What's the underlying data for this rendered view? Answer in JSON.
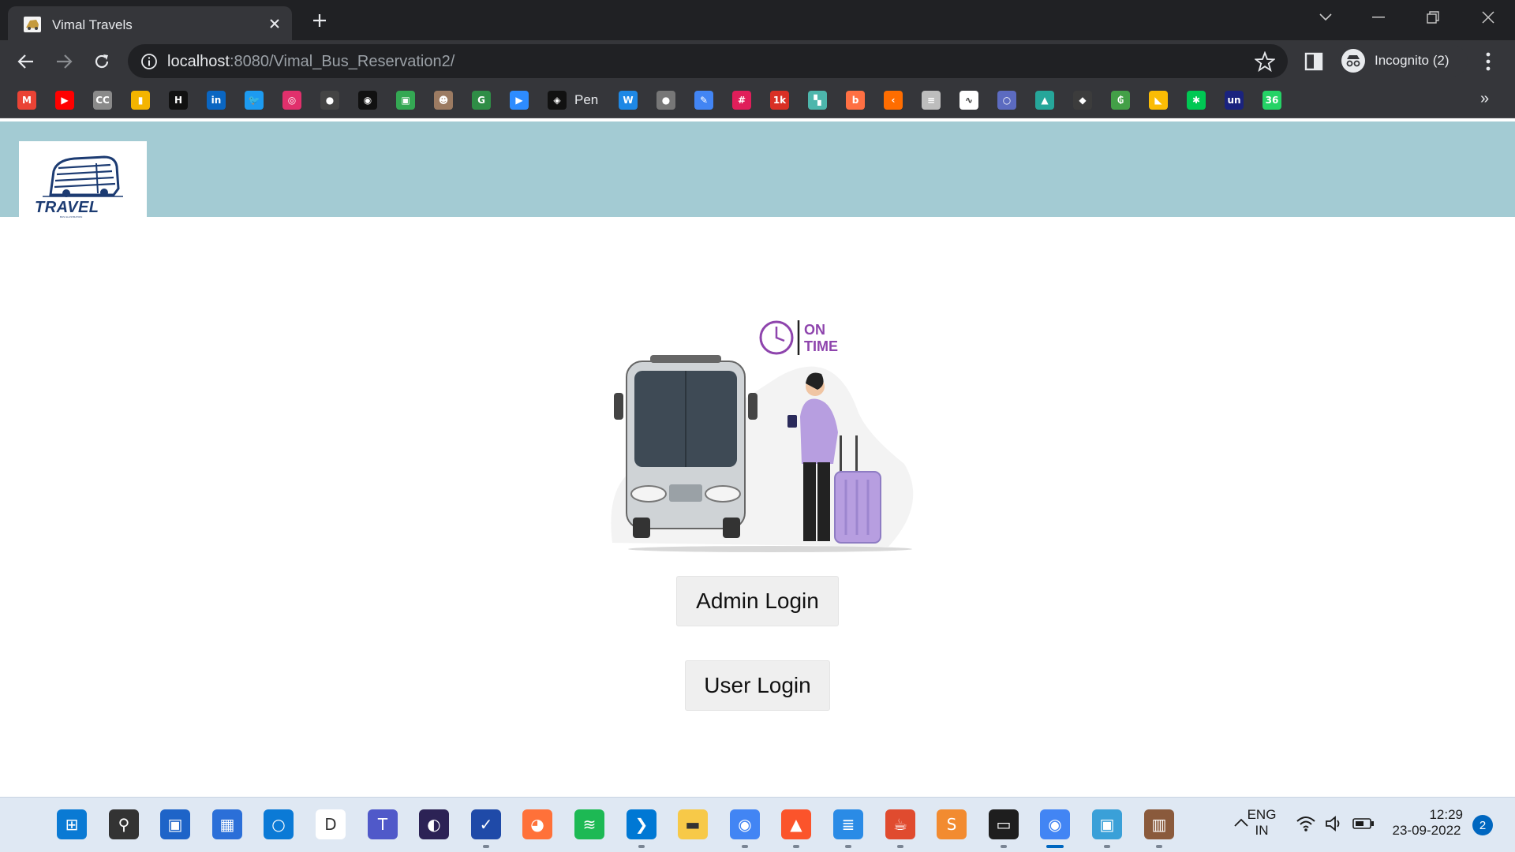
{
  "browser": {
    "tab_title": "Vimal Travels",
    "url_host": "localhost",
    "url_path": ":8080/Vimal_Bus_Reservation2/",
    "profile_label": "Incognito (2)",
    "bookmarks": [
      {
        "icon": "gmail-icon",
        "color": "#ea4335",
        "glyph": "M"
      },
      {
        "icon": "youtube-icon",
        "color": "#ff0000",
        "glyph": "▶"
      },
      {
        "icon": "cc-icon",
        "color": "#8a8a8a",
        "glyph": "CC"
      },
      {
        "icon": "analytics-icon",
        "color": "#f4b400",
        "glyph": "▮"
      },
      {
        "icon": "hackerrank-icon",
        "color": "#111111",
        "glyph": "H"
      },
      {
        "icon": "linkedin-icon",
        "color": "#0a66c2",
        "glyph": "in"
      },
      {
        "icon": "twitter-icon",
        "color": "#1d9bf0",
        "glyph": "🐦"
      },
      {
        "icon": "instagram-icon",
        "color": "#e1306c",
        "glyph": "◎"
      },
      {
        "icon": "github-icon",
        "color": "#444444",
        "glyph": "●"
      },
      {
        "icon": "target-icon",
        "color": "#111111",
        "glyph": "◉"
      },
      {
        "icon": "maps-icon",
        "color": "#34a853",
        "glyph": "▣"
      },
      {
        "icon": "profile-icon",
        "color": "#9c7b62",
        "glyph": "☻"
      },
      {
        "icon": "geeksforgeeks-icon",
        "color": "#2f8d46",
        "glyph": "G"
      },
      {
        "icon": "zoom-icon",
        "color": "#2d8cff",
        "glyph": "▶"
      },
      {
        "icon": "codepen-icon",
        "color": "#111111",
        "glyph": "◈"
      },
      {
        "icon": "webflow-icon",
        "color": "#1e88e5",
        "glyph": "W"
      },
      {
        "icon": "globe-icon",
        "color": "#777777",
        "glyph": "●"
      },
      {
        "icon": "pen-tool-icon",
        "color": "#4285f4",
        "glyph": "✎"
      },
      {
        "icon": "slack-icon",
        "color": "#e01e5a",
        "glyph": "#"
      },
      {
        "icon": "counter-icon",
        "color": "#d93025",
        "glyph": "1k"
      },
      {
        "icon": "tiles-icon",
        "color": "#4db6ac",
        "glyph": "▚"
      },
      {
        "icon": "blogger-icon",
        "color": "#ff7043",
        "glyph": "b"
      },
      {
        "icon": "kite-icon",
        "color": "#ff6d00",
        "glyph": "‹"
      },
      {
        "icon": "document-icon",
        "color": "#bdbdbd",
        "glyph": "≡"
      },
      {
        "icon": "chart-icon",
        "color": "#ffffff",
        "glyph": "∿"
      },
      {
        "icon": "ring-icon",
        "color": "#5c6bc0",
        "glyph": "○"
      },
      {
        "icon": "tree-icon",
        "color": "#26a69a",
        "glyph": "▲"
      },
      {
        "icon": "dark-icon",
        "color": "#3c3c3c",
        "glyph": "◆"
      },
      {
        "icon": "currency-icon",
        "color": "#43a047",
        "glyph": "₲"
      },
      {
        "icon": "drive-icon",
        "color": "#fbbc04",
        "glyph": "◣"
      },
      {
        "icon": "asterisk-icon",
        "color": "#00c853",
        "glyph": "✱"
      },
      {
        "icon": "unacademy-icon",
        "color": "#1a237e",
        "glyph": "un"
      },
      {
        "icon": "whatsapp-icon",
        "color": "#25d366",
        "glyph": "36"
      }
    ],
    "bookmark_pen_label": "Pen"
  },
  "page": {
    "logo_text": "TRAVEL",
    "logo_subtext": "BUS ILLUSTRATION",
    "hero_badge_line1": "ON",
    "hero_badge_line2": "TIME",
    "admin_login_label": "Admin Login",
    "user_login_label": "User Login",
    "colors": {
      "header_band": "#a3cbd3",
      "button_bg": "#efefef",
      "logo_blue": "#1c3b72",
      "accent_purple": "#8e44ad"
    }
  },
  "taskbar": {
    "apps": [
      "windows-start-icon",
      "search-icon",
      "widgets-icon",
      "store-icon",
      "cortana-icon",
      "dare2compete-icon",
      "teams-icon",
      "eclipse-icon",
      "whiteboard-icon",
      "firefox-icon",
      "spotify-icon",
      "vscode-icon",
      "file-explorer-icon",
      "chrome-icon",
      "brave-icon",
      "notepad-icon",
      "java-icon",
      "sublime-icon",
      "terminal-icon",
      "chrome-profile-icon",
      "remote-desktop-icon",
      "box-icon"
    ],
    "language_line1": "ENG",
    "language_line2": "IN",
    "time": "12:29",
    "date": "23-09-2022",
    "notification_count": "2"
  }
}
